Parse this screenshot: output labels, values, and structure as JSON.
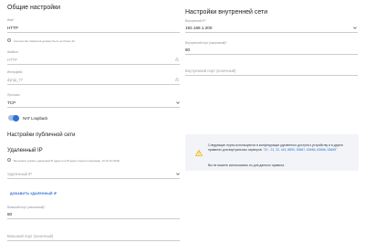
{
  "general": {
    "title": "Общие настройки",
    "name_label": "Имя*",
    "name_value": "HTTP",
    "name_hint": "Количество символов должно быть не более 32",
    "source_label": "Шаблон",
    "source_value": "HTTP",
    "interface_label": "Интерфейс",
    "interface_value": "dynip_77",
    "protocol_label": "Протокол",
    "protocol_value": "TCP",
    "nat_label": "NAT Loopback"
  },
  "internal": {
    "title": "Настройки внутренней сети",
    "ip_label": "Внутренний IP*",
    "ip_value": "192.168.1.200",
    "port_label": "Внутренний порт (начальный)*",
    "port_value": "80",
    "port_end_placeholder": "Внутренний порт (конечный)"
  },
  "public": {
    "title": "Настройки публичной сети",
    "remote_ip_title": "Удаленный IP",
    "remote_ip_hint": "Вы можете указать удаленный IP-адрес или IP-адрес подсети (например, 10.10.10.10/24)",
    "remote_ip_placeholder": "Удаленный IP",
    "add_remote_ip": "ДОБАВИТЬ УДАЛЕННЫЙ IP",
    "ext_port_label": "Внешний порт (начальный)*",
    "ext_port_value": "80",
    "ext_port_end_placeholder": "Внешний порт (конечный)"
  },
  "warning": {
    "text": "Следующие порты используются в конфигурации удаленного доступа к устройству и в других правилах для виртуальных серверов: ",
    "ports": "\"20 - 21, 22, 443, 8890, 53667, 63666, 63668, 63669\"",
    "note": "Вы не можете использовать их для данного правила."
  },
  "colors": {
    "accent": "#2f6fd6",
    "warning_icon": "#f0b400"
  }
}
